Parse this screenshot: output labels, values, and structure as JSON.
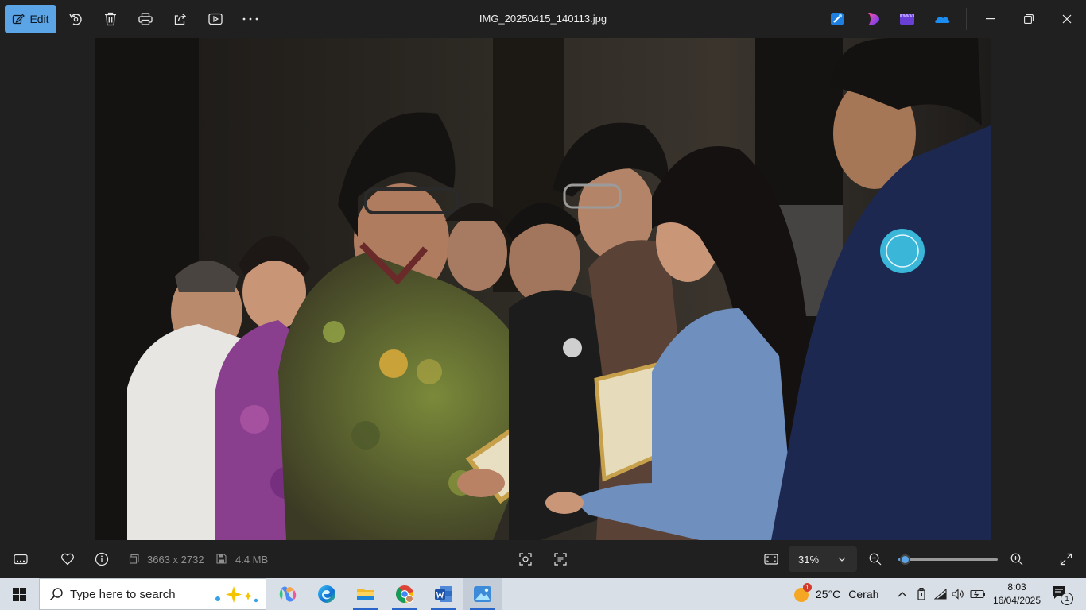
{
  "toolbar": {
    "edit_label": "Edit",
    "icons": [
      "edit-icon",
      "rotate-icon",
      "delete-icon",
      "print-icon",
      "share-icon",
      "slideshow-icon",
      "more-icon"
    ]
  },
  "window": {
    "title": "IMG_20250415_140113.jpg",
    "app_icons": [
      "designer-icon",
      "clipchamp-icon",
      "video-editor-icon",
      "onedrive-icon"
    ],
    "controls": [
      "minimize-icon",
      "restore-icon",
      "close-icon"
    ]
  },
  "image_info": {
    "dimensions": "3663 x 2732",
    "file_size": "4.4 MB"
  },
  "zoom": {
    "value": "31%",
    "slider_fraction": 0.06
  },
  "taskbar": {
    "search_placeholder": "Type here to search",
    "pinned_apps": [
      "copilot-icon",
      "edge-icon",
      "file-explorer-icon",
      "chrome-icon",
      "word-icon",
      "photos-icon"
    ]
  },
  "weather": {
    "temperature": "25°C",
    "condition": "Cerah",
    "badge": "1"
  },
  "clock": {
    "time": "8:03",
    "date": "16/04/2025"
  },
  "notifications": {
    "count": "1"
  },
  "colors": {
    "accent": "#5ba4e5",
    "background": "#202020",
    "taskbar": "#d9dfe7"
  }
}
